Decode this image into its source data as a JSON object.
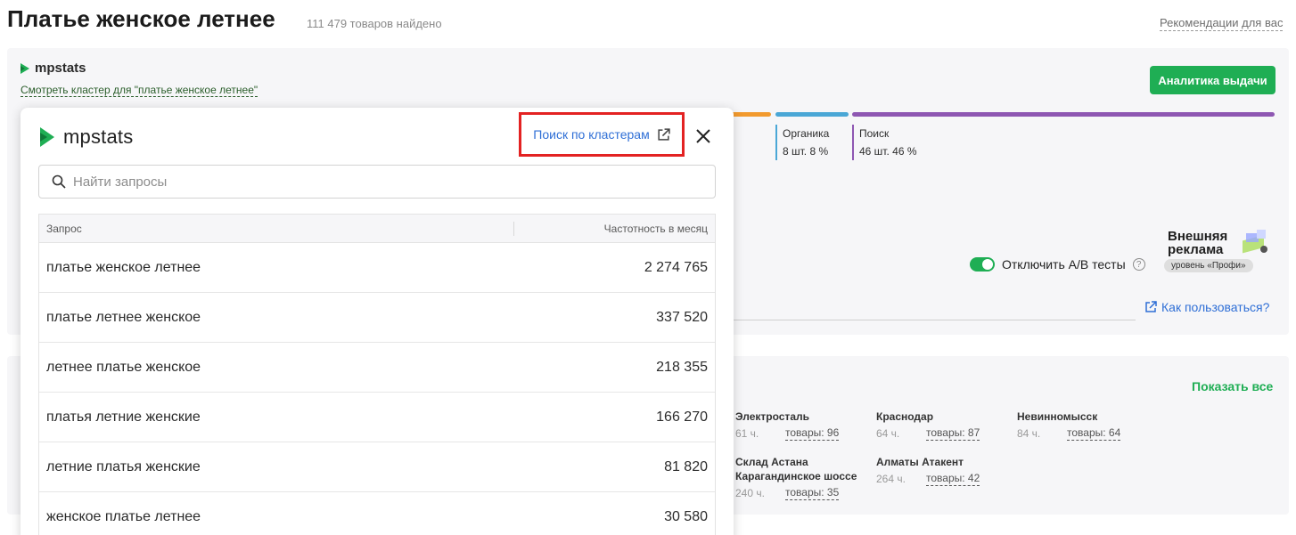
{
  "header": {
    "title": "Платье женское летнее",
    "found": "111 479 товаров найдено",
    "recommendations": "Рекомендации для вас"
  },
  "mpstats_block": {
    "brand": "mpstats",
    "cluster_link": "Смотреть кластер для \"платье женское летнее\"",
    "analytics_button": "Аналитика выдачи",
    "segments": [
      {
        "label": "Органика",
        "value": "8 шт. 8 %",
        "color": "#4aa7d6"
      },
      {
        "label": "Поиск",
        "value": "46 шт. 46 %",
        "color": "#8e57b2"
      }
    ],
    "bar_colors": [
      "#f29a2e",
      "#4aa7d6",
      "#8e57b2"
    ],
    "ad_banner": {
      "line1": "Внешняя",
      "line2": "реклама",
      "level": "уровень «Профи»"
    },
    "ab_toggle": {
      "label": "Отключить А/В тесты",
      "on": true
    },
    "howto": "Как пользоваться?"
  },
  "warehouses": {
    "show_all": "Показать все",
    "items": [
      {
        "name": "Электросталь",
        "hours": "61 ч.",
        "goods": "товары: 96"
      },
      {
        "name": "Краснодар",
        "hours": "64 ч.",
        "goods": "товары: 87"
      },
      {
        "name": "Невинномысск",
        "hours": "84 ч.",
        "goods": "товары: 64"
      },
      {
        "name": "Склад Астана",
        "name2": "Карагандинское шоссе",
        "hours": "240 ч.",
        "goods": "товары: 35"
      },
      {
        "name": "Алматы Атакент",
        "hours": "264 ч.",
        "goods": "товары: 42"
      }
    ]
  },
  "popup": {
    "brand": "mpstats",
    "cluster_search": "Поиск по кластерам",
    "search_placeholder": "Найти запросы",
    "table": {
      "col_query": "Запрос",
      "col_freq": "Частотность в месяц",
      "rows": [
        {
          "query": "платье женское летнее",
          "freq": "2 274 765"
        },
        {
          "query": "платье летнее женское",
          "freq": "337 520"
        },
        {
          "query": "летнее платье женское",
          "freq": "218 355"
        },
        {
          "query": "платья летние женские",
          "freq": "166 270"
        },
        {
          "query": "летние платья женские",
          "freq": "81 820"
        },
        {
          "query": "женское платье летнее",
          "freq": "30 580"
        }
      ]
    }
  },
  "colors": {
    "accent_green": "#1fae54",
    "link_blue": "#2f6fd6",
    "highlight_red": "#e32222"
  }
}
